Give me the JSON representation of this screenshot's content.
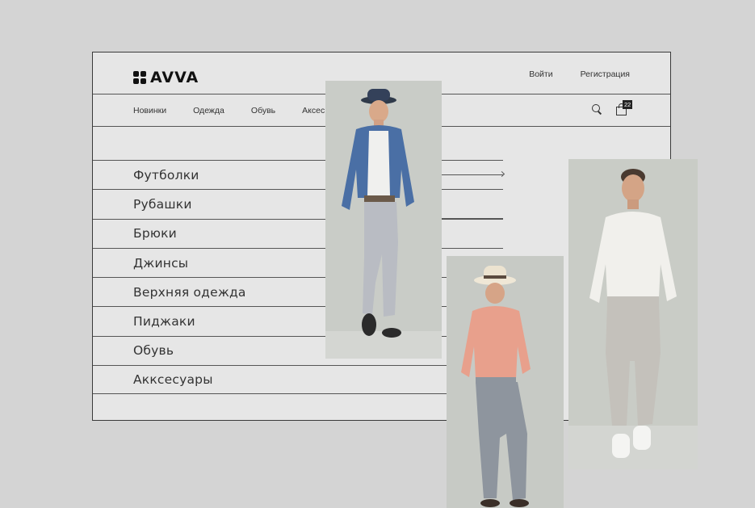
{
  "header": {
    "logo_text": "AVVA",
    "login_label": "Войти",
    "register_label": "Регистрация"
  },
  "nav": {
    "items": [
      "Новинки",
      "Одежда",
      "Обувь",
      "Аксес"
    ],
    "cart_count": "22"
  },
  "menu": {
    "items": [
      "Футболки",
      "Рубашки",
      "Брюки",
      "Джинсы",
      "Верхняя одежда",
      "Пиджаки",
      "Обувь",
      "Акксесуары"
    ]
  },
  "photos": {
    "colors": {
      "backdrop": "#c9ccc7",
      "blue_shirt": "#4a6fa5",
      "pink_shirt": "#e8a08c",
      "white_shirt": "#f1f0ec",
      "grey_trousers": "#8e959e",
      "light_trousers": "#c4c1bb"
    }
  }
}
